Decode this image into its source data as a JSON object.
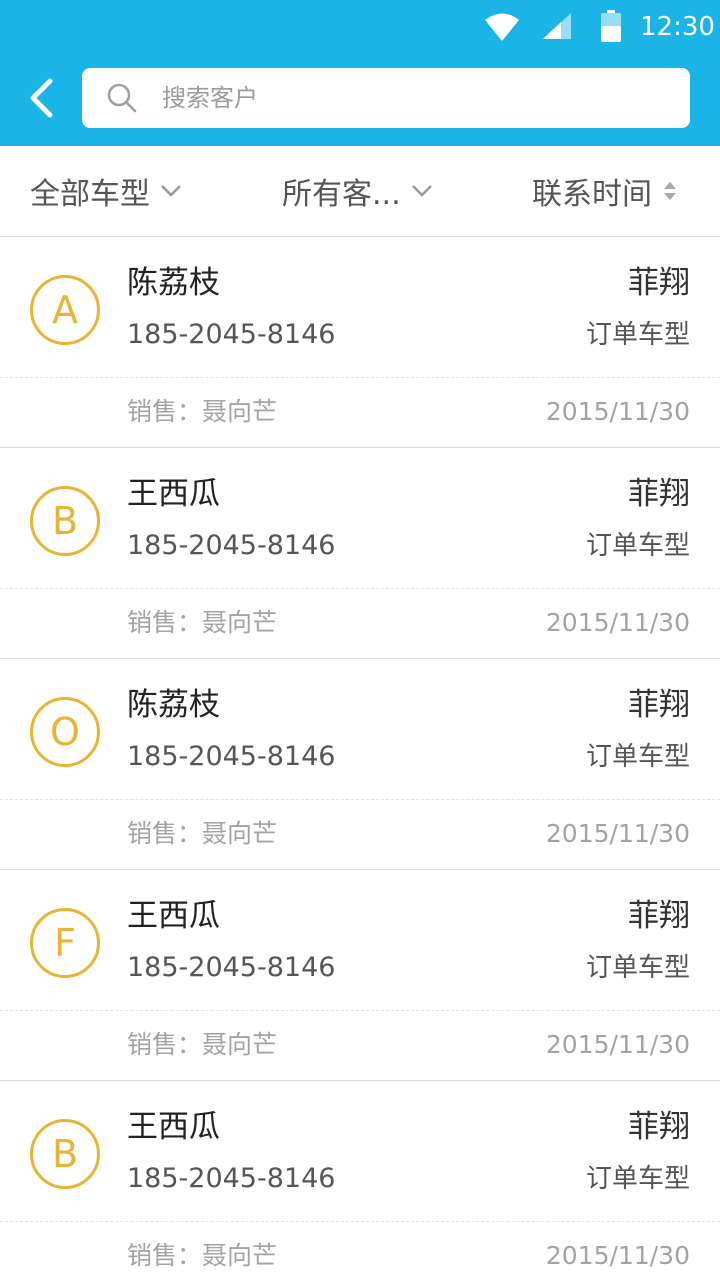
{
  "status_bar": {
    "time": "12:30",
    "icons": [
      "wifi-icon",
      "signal-icon",
      "battery-icon"
    ]
  },
  "header": {
    "back_icon": "chevron-left-icon",
    "search": {
      "icon": "search-icon",
      "placeholder": "搜索客户",
      "value": ""
    }
  },
  "filters": {
    "car_type": {
      "label": "全部车型",
      "icon": "chevron-down-icon"
    },
    "customer_type": {
      "label": "所有客...",
      "icon": "chevron-down-icon"
    },
    "contact_time": {
      "label": "联系时间",
      "icon": "sort-icon"
    }
  },
  "customers": [
    {
      "initial": "A",
      "name": "陈荔枝",
      "phone": "185-2045-8146",
      "brand": "菲翔",
      "order_label": "订单车型",
      "sales_label": "销售：",
      "sales_name": "聂向芒",
      "date": "2015/11/30"
    },
    {
      "initial": "B",
      "name": "王西瓜",
      "phone": "185-2045-8146",
      "brand": "菲翔",
      "order_label": "订单车型",
      "sales_label": "销售：",
      "sales_name": "聂向芒",
      "date": "2015/11/30"
    },
    {
      "initial": "O",
      "name": "陈荔枝",
      "phone": "185-2045-8146",
      "brand": "菲翔",
      "order_label": "订单车型",
      "sales_label": "销售：",
      "sales_name": "聂向芒",
      "date": "2015/11/30"
    },
    {
      "initial": "F",
      "name": "王西瓜",
      "phone": "185-2045-8146",
      "brand": "菲翔",
      "order_label": "订单车型",
      "sales_label": "销售：",
      "sales_name": "聂向芒",
      "date": "2015/11/30"
    },
    {
      "initial": "B",
      "name": "王西瓜",
      "phone": "185-2045-8146",
      "brand": "菲翔",
      "order_label": "订单车型",
      "sales_label": "销售：",
      "sales_name": "聂向芒",
      "date": "2015/11/30"
    }
  ],
  "colors": {
    "header_bg": "#1ab5e6",
    "avatar_accent": "#e9b435",
    "text_primary": "#222222",
    "text_muted": "#a3a3a3"
  }
}
